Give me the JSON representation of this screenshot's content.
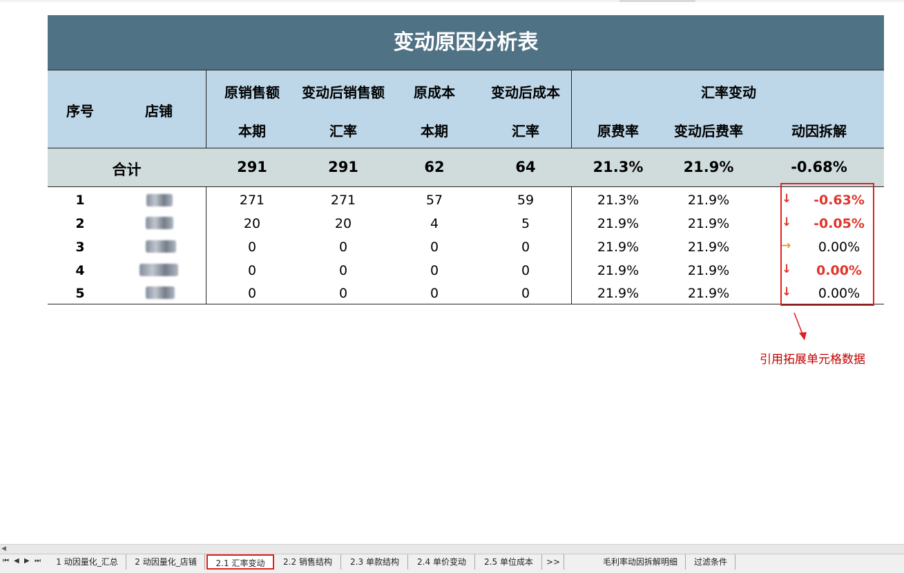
{
  "table": {
    "title": "变动原因分析表",
    "headers": {
      "seq": "序号",
      "store": "店铺",
      "orig_sales": "原销售额",
      "orig_sales_sub": "本期",
      "new_sales": "变动后销售额",
      "new_sales_sub": "汇率",
      "orig_cost": "原成本",
      "orig_cost_sub": "本期",
      "new_cost": "变动后成本",
      "new_cost_sub": "汇率",
      "fx_group": "汇率变动",
      "orig_rate": "原费率",
      "new_rate": "变动后费率",
      "driver": "动因拆解"
    },
    "total": {
      "label": "合计",
      "orig_sales": "291",
      "new_sales": "291",
      "orig_cost": "62",
      "new_cost": "64",
      "orig_rate": "21.3%",
      "new_rate": "21.9%",
      "driver": "-0.68%"
    },
    "rows": [
      {
        "seq": "1",
        "orig_sales": "271",
        "new_sales": "271",
        "orig_cost": "57",
        "new_cost": "59",
        "orig_rate": "21.3%",
        "new_rate": "21.9%",
        "arrow": "down",
        "driver": "-0.63%",
        "driver_style": "neg"
      },
      {
        "seq": "2",
        "orig_sales": "20",
        "new_sales": "20",
        "orig_cost": "4",
        "new_cost": "5",
        "orig_rate": "21.9%",
        "new_rate": "21.9%",
        "arrow": "down",
        "driver": "-0.05%",
        "driver_style": "neg"
      },
      {
        "seq": "3",
        "orig_sales": "0",
        "new_sales": "0",
        "orig_cost": "0",
        "new_cost": "0",
        "orig_rate": "21.9%",
        "new_rate": "21.9%",
        "arrow": "right",
        "driver": "0.00%",
        "driver_style": "plain"
      },
      {
        "seq": "4",
        "orig_sales": "0",
        "new_sales": "0",
        "orig_cost": "0",
        "new_cost": "0",
        "orig_rate": "21.9%",
        "new_rate": "21.9%",
        "arrow": "down",
        "driver": "0.00%",
        "driver_style": "neg"
      },
      {
        "seq": "5",
        "orig_sales": "0",
        "new_sales": "0",
        "orig_cost": "0",
        "new_cost": "0",
        "orig_rate": "21.9%",
        "new_rate": "21.9%",
        "arrow": "down",
        "driver": "0.00%",
        "driver_style": "plain"
      }
    ]
  },
  "annotation": {
    "text": "引用拓展单元格数据",
    "color": "#c00000"
  },
  "icons": {
    "down": "arrow-down-icon",
    "right": "arrow-right-icon"
  },
  "colors": {
    "title_bg": "#507285",
    "header_bg": "#bdd7e8",
    "total_bg": "#d0dcdc",
    "negative": "#e0352b",
    "flat_arrow": "#e69a2e",
    "highlight": "#e02020"
  },
  "sheet_tabs": {
    "nav": [
      "⏮",
      "◀",
      "▶",
      "⏭"
    ],
    "items": [
      {
        "label": "1 动因量化_汇总"
      },
      {
        "label": "2 动因量化_店铺"
      },
      {
        "label": "2.1 汇率变动",
        "active": true
      },
      {
        "label": "2.2 销售结构"
      },
      {
        "label": "2.3 单款结构"
      },
      {
        "label": "2.4 单价变动"
      },
      {
        "label": "2.5 单位成本"
      },
      {
        "label": ">>"
      },
      {
        "label": "毛利率动因拆解明细"
      },
      {
        "label": "过滤条件"
      }
    ]
  }
}
